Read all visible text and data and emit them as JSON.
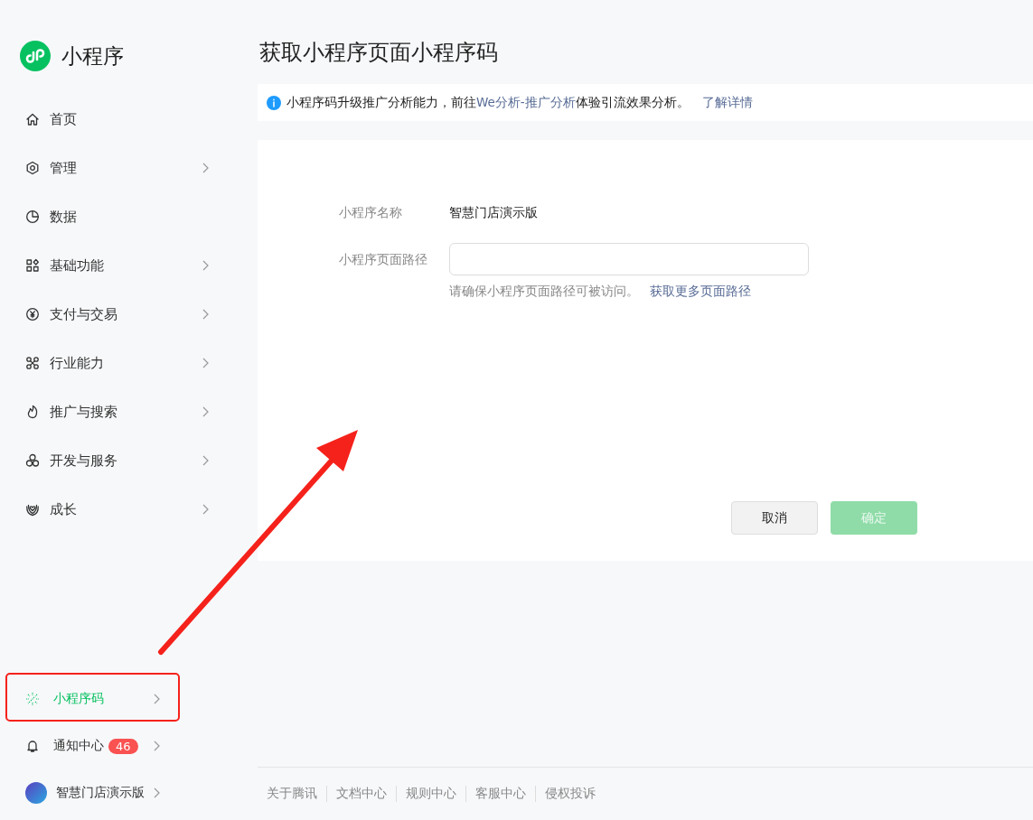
{
  "sidebar": {
    "logo_text": "小程序",
    "items": [
      {
        "label": "首页",
        "has_arrow": false,
        "selected": false
      },
      {
        "label": "管理",
        "has_arrow": true,
        "selected": false
      },
      {
        "label": "数据",
        "has_arrow": false,
        "selected": false
      },
      {
        "label": "基础功能",
        "has_arrow": true,
        "selected": false
      },
      {
        "label": "支付与交易",
        "has_arrow": true,
        "selected": false
      },
      {
        "label": "行业能力",
        "has_arrow": true,
        "selected": false
      },
      {
        "label": "推广与搜索",
        "has_arrow": true,
        "selected": false
      },
      {
        "label": "开发与服务",
        "has_arrow": true,
        "selected": false
      },
      {
        "label": "成长",
        "has_arrow": true,
        "selected": false
      }
    ],
    "bottom_items": [
      {
        "kind": "nav",
        "label": "小程序码",
        "selected": true
      },
      {
        "kind": "notice",
        "label": "通知中心",
        "badge": "46",
        "selected": false
      },
      {
        "kind": "account",
        "label": "智慧门店演示版",
        "selected": false
      }
    ]
  },
  "page_title": "获取小程序页面小程序码",
  "notice": {
    "text": "小程序码升级推广分析能力，前往",
    "link": "We分析-推广分析",
    "text_after": "体验引流效果分析。",
    "more_link": "了解详情"
  },
  "form": {
    "name_label": "小程序名称",
    "name_value": "智慧门店演示版",
    "path_label": "小程序页面路径",
    "hint": "请确保小程序页面路径可被访问。",
    "hint_link": "获取更多页面路径"
  },
  "buttons": [
    {
      "label": "取消",
      "kind": "default",
      "disabled": false
    },
    {
      "label": "确定",
      "kind": "primary",
      "disabled": true
    }
  ],
  "footer_links": [
    "关于腾讯",
    "文档中心",
    "规则中心",
    "客服中心",
    "侵权投诉"
  ],
  "highlight_frame": true,
  "pointer_arrow": true
}
